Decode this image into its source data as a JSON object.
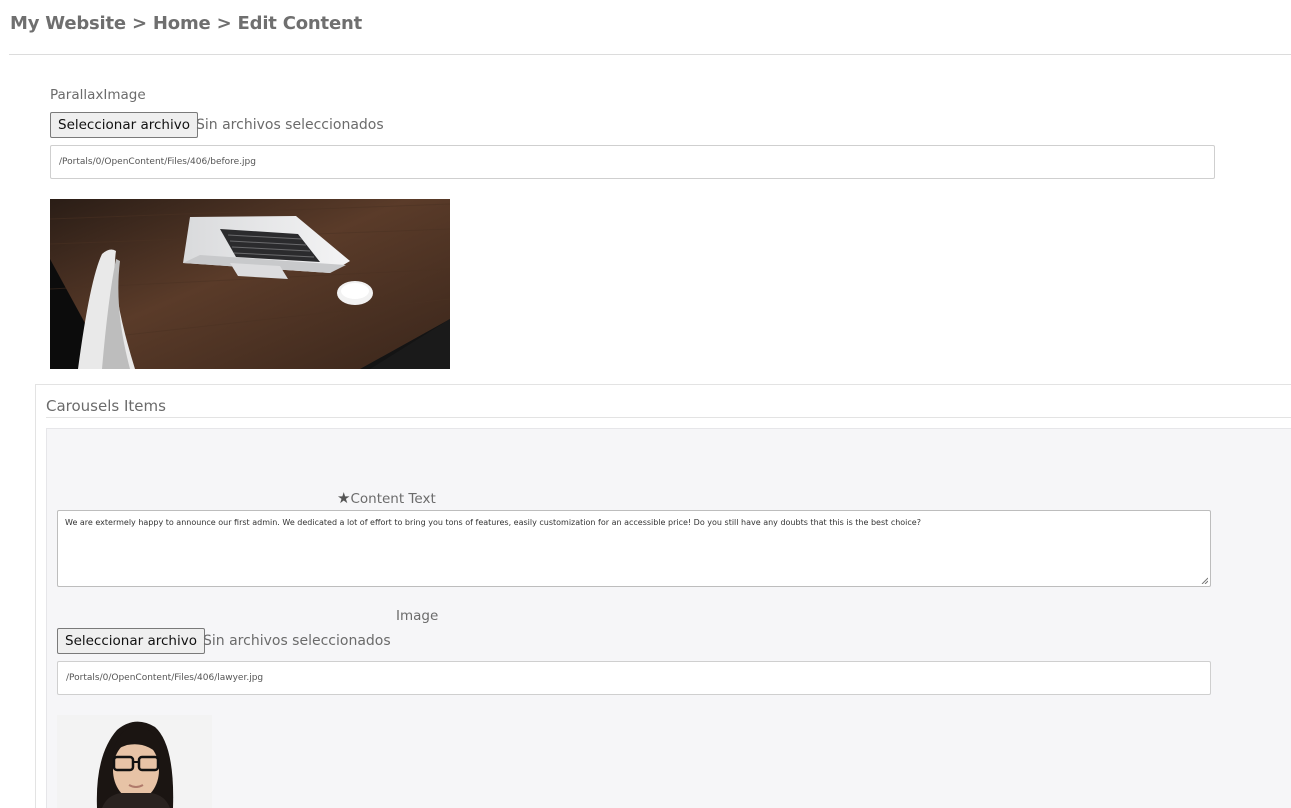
{
  "breadcrumb": {
    "text": "My Website > Home > Edit Content"
  },
  "parallax": {
    "label": "ParallaxImage",
    "file_button": "Seleccionar archivo",
    "file_status": "Sin archivos seleccionados",
    "path_value": "/Portals/0/OpenContent/Files/406/before.jpg"
  },
  "carousel": {
    "title": "Carousels Items",
    "content_label": "Content Text",
    "content_value": "We are extermely happy to announce our first admin. We dedicated a lot of effort to bring you tons of features, easily customization for an accessible price! Do you still have any doubts that this is the best choice?",
    "image_label": "Image",
    "file_button": "Seleccionar archivo",
    "file_status": "Sin archivos seleccionados",
    "path_value": "/Portals/0/OpenContent/Files/406/lawyer.jpg"
  },
  "icons": {
    "required": "star-icon",
    "laptop_preview": "laptop-photo",
    "person_preview": "person-photo"
  }
}
